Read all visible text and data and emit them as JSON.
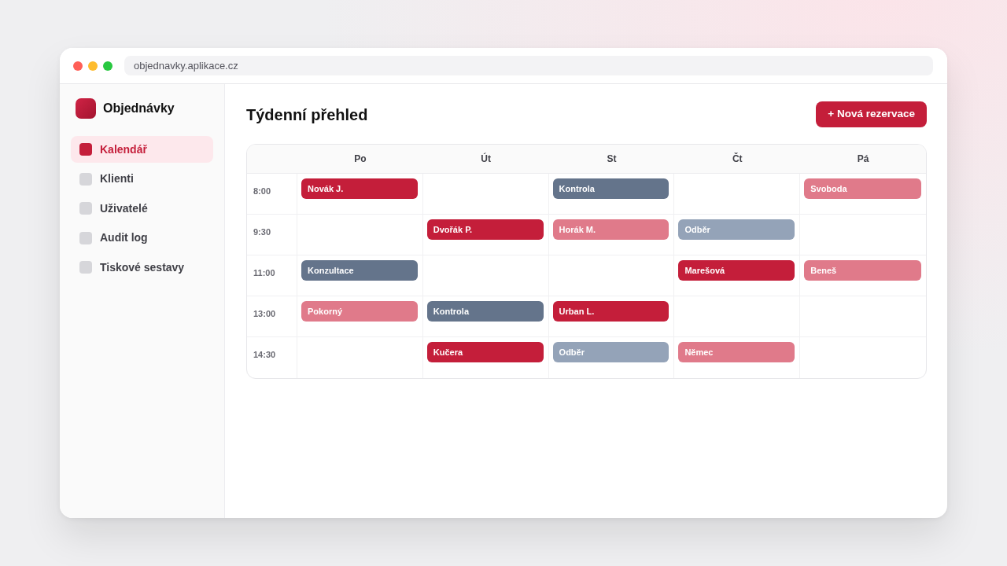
{
  "window": {
    "url": "objednavky.aplikace.cz"
  },
  "sidebar": {
    "app_name": "Objednávky",
    "items": [
      {
        "label": "Kalendář",
        "selected": true
      },
      {
        "label": "Klienti",
        "selected": false
      },
      {
        "label": "Uživatelé",
        "selected": false
      },
      {
        "label": "Audit log",
        "selected": false
      },
      {
        "label": "Tiskové sestavy",
        "selected": false
      }
    ]
  },
  "main": {
    "title": "Týdenní přehled",
    "new_button": "+ Nová rezervace"
  },
  "calendar": {
    "days": [
      "Po",
      "Út",
      "St",
      "Čt",
      "Pá"
    ],
    "rows": [
      {
        "time": "8:00",
        "cells": [
          {
            "label": "Novák J.",
            "color": "#c41e3a"
          },
          null,
          {
            "label": "Kontrola",
            "color": "#64748b"
          },
          null,
          {
            "label": "Svoboda",
            "color": "#e07a8a"
          }
        ]
      },
      {
        "time": "9:30",
        "cells": [
          null,
          {
            "label": "Dvořák P.",
            "color": "#c41e3a"
          },
          {
            "label": "Horák M.",
            "color": "#e07a8a"
          },
          {
            "label": "Odběr",
            "color": "#94a3b8"
          },
          null
        ]
      },
      {
        "time": "11:00",
        "cells": [
          {
            "label": "Konzultace",
            "color": "#64748b"
          },
          null,
          null,
          {
            "label": "Marešová",
            "color": "#c41e3a"
          },
          {
            "label": "Beneš",
            "color": "#e07a8a"
          }
        ]
      },
      {
        "time": "13:00",
        "cells": [
          {
            "label": "Pokorný",
            "color": "#e07a8a"
          },
          {
            "label": "Kontrola",
            "color": "#64748b"
          },
          {
            "label": "Urban L.",
            "color": "#c41e3a"
          },
          null,
          null
        ]
      },
      {
        "time": "14:30",
        "cells": [
          null,
          {
            "label": "Kučera",
            "color": "#c41e3a"
          },
          {
            "label": "Odběr",
            "color": "#94a3b8"
          },
          {
            "label": "Němec",
            "color": "#e07a8a"
          },
          null
        ]
      }
    ]
  }
}
